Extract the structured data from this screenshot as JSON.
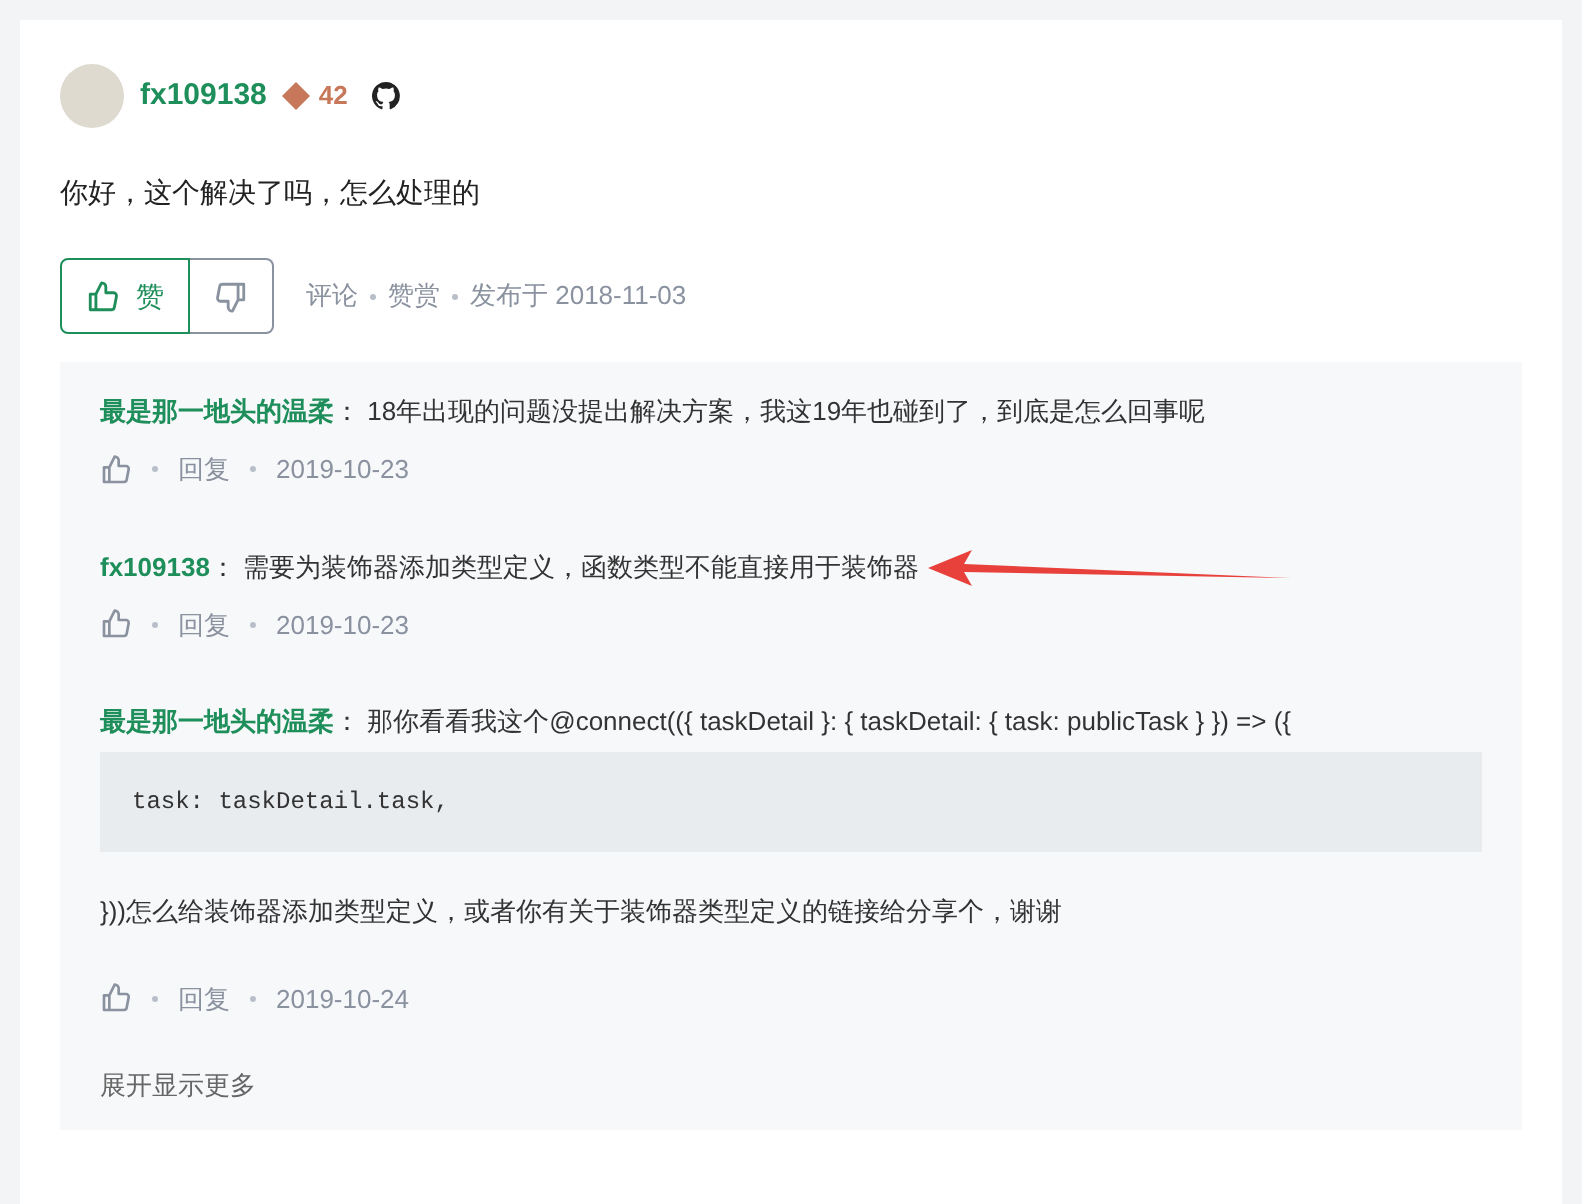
{
  "post": {
    "author": "fx109138",
    "level": "42",
    "text": "你好，这个解决了吗，怎么处理的",
    "like_label": "赞",
    "meta": [
      "评论",
      "赞赏",
      "发布于 2018-11-03"
    ]
  },
  "replies": [
    {
      "author": "最是那一地头的温柔",
      "separator": "：",
      "text": "18年出现的问题没提出解决方案，我这19年也碰到了，到底是怎么回事呢",
      "reply_label": "回复",
      "date": "2019-10-23",
      "arrow": false
    },
    {
      "author": "fx109138",
      "separator": "：",
      "text": "需要为装饰器添加类型定义，函数类型不能直接用于装饰器",
      "reply_label": "回复",
      "date": "2019-10-23",
      "arrow": true
    },
    {
      "author": "最是那一地头的温柔",
      "separator": "：",
      "text": "那你看看我这个@connect(({ taskDetail }: { taskDetail: { task: publicTask } }) => ({",
      "code": "task: taskDetail.task,",
      "text_after": "}))怎么给装饰器添加类型定义，或者你有关于装饰器类型定义的链接给分享个，谢谢",
      "reply_label": "回复",
      "date": "2019-10-24",
      "arrow": false
    }
  ],
  "expand": "展开显示更多"
}
